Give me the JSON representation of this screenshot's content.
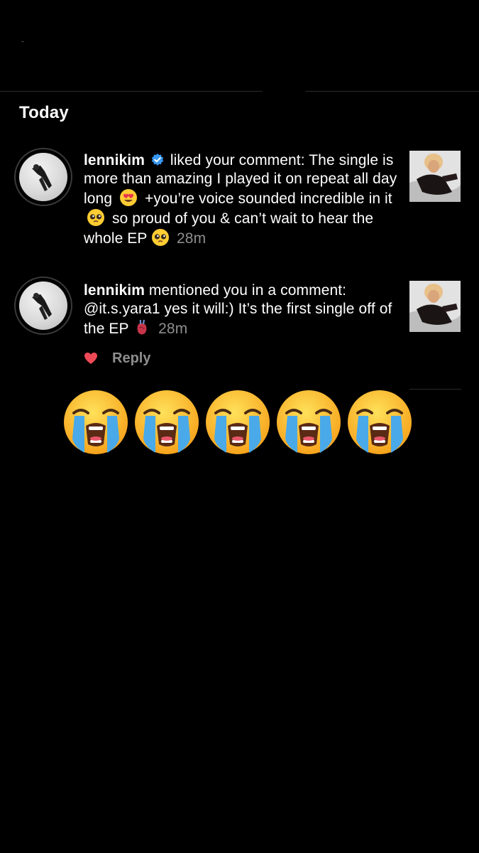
{
  "section": {
    "title": "Today"
  },
  "notifications": [
    {
      "username": "lennikim",
      "text1": " liked your comment: The single is more than amazing I played it on repeat all day long",
      "text2": "+you’re voice sounded incredible in it",
      "text3": "so proud of you & can’t wait to hear the whole EP",
      "time": "28m",
      "emoji1": "heart-eyes-emoji",
      "emoji2": "pleading-face-emoji",
      "emoji3": "pleading-face-emoji"
    },
    {
      "username": "lennikim",
      "text1": " mentioned you in a comment: @it.s.yara1 yes it will:) It’s the first single off of the EP",
      "time": "28m",
      "emoji1": "anatomical-heart-emoji"
    }
  ],
  "actions": {
    "reply_label": "Reply",
    "like_icon": "heart-icon"
  },
  "reaction": {
    "emoji": "loudly-crying-face",
    "count": 5
  },
  "colors": {
    "background": "#000000",
    "text": "#ffffff",
    "muted": "#8e8e8e",
    "verified": "#3897f0",
    "like": "#ed4956"
  }
}
